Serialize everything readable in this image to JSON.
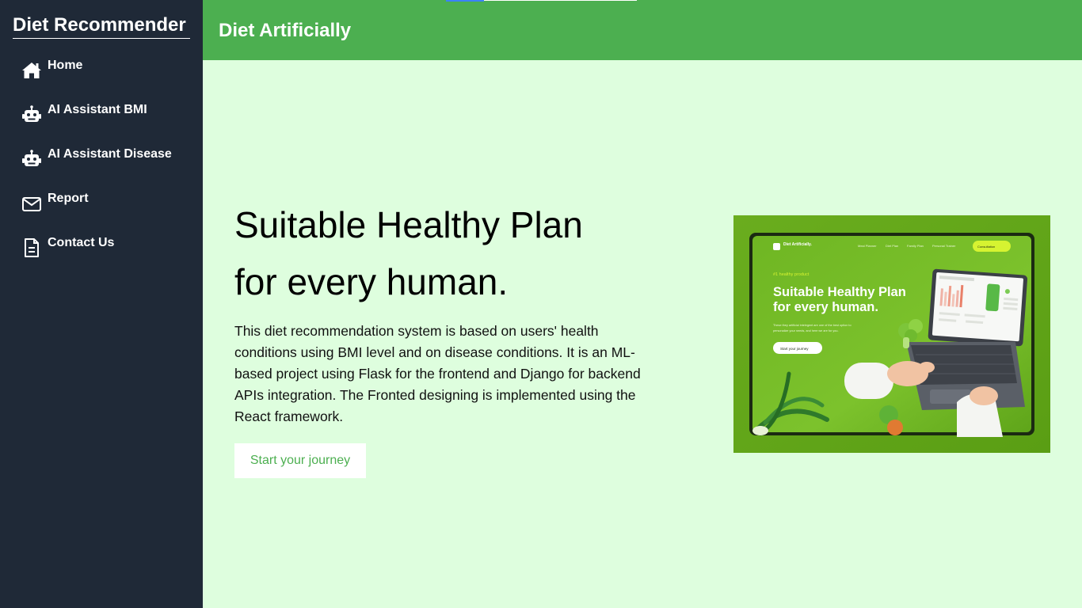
{
  "sidebar": {
    "title": "Diet Recommender",
    "items": [
      {
        "label": "Home",
        "icon": "home-icon"
      },
      {
        "label": "AI Assistant BMI",
        "icon": "robot-icon"
      },
      {
        "label": "AI Assistant Disease",
        "icon": "robot-icon"
      },
      {
        "label": "Report",
        "icon": "envelope-icon"
      },
      {
        "label": "Contact Us",
        "icon": "document-icon"
      }
    ]
  },
  "header": {
    "title": "Diet Artificially"
  },
  "hero": {
    "title_line1": "Suitable Healthy Plan",
    "title_line2": "for every human.",
    "description": "This diet recommendation system is based on users' health conditions using BMI level and on disease conditions. It is an ML-based project using Flask for the frontend and Django for backend APIs integration. The Fronted designing is implemented using the React framework.",
    "cta_label": "Start your journey"
  },
  "preview": {
    "brand": "Diet Artificially.",
    "nav": [
      "Meal Planner",
      "Diet Plan",
      "Family Plan",
      "Personal Trainer"
    ],
    "nav_button": "Consultation",
    "tag": "#1 healthy product",
    "title_line1": "Suitable Healthy Plan",
    "title_line2": "for every human.",
    "body_line1": "These they artificial intelegent are one of the best option to",
    "body_line2": "personalize your needs, and here we are for you.",
    "button": "Start your journey"
  },
  "colors": {
    "sidebar_bg": "#1f2937",
    "header_bg": "#4caf50",
    "page_bg": "#defede",
    "accent": "#4caf50",
    "preview_bg": "#6aad1e"
  }
}
